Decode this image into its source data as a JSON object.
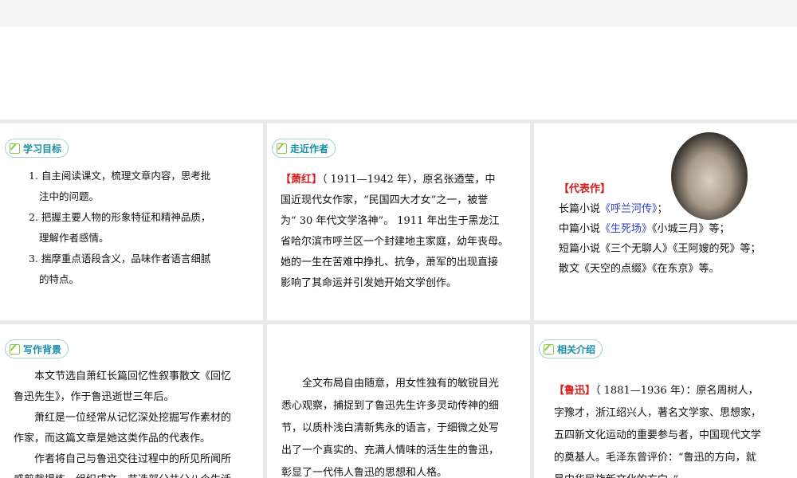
{
  "slides": {
    "goals": {
      "tag": "学习目标",
      "items": [
        {
          "line1": "1. 自主阅读课文，梳理文章内容，思考批",
          "line2": "注中的问题。"
        },
        {
          "line1": "2. 把握主要人物的形象特征和精神品质，",
          "line2": "理解作者感情。"
        },
        {
          "line1": "3. 揣摩重点语段含义，品味作者语言细腻",
          "line2": "的特点。"
        }
      ]
    },
    "author": {
      "tag": "走近作者",
      "name": "【萧红】",
      "lines": [
        "（ 1911—1942 年），原名张迺莹，中",
        "国近现代女作家，“民国四大才女”之一，被誉",
        "为“ 30 年代文学洛神”。 1911 年出生于黑龙江",
        "省哈尔滨市呼兰区一个封建地主家庭，幼年丧母。",
        "她的一生在苦难中挣扎、抗争，萧军的出现直接",
        "影响了其命运并引发她开始文学创作。"
      ]
    },
    "works": {
      "heading": "【代表作】",
      "l1_prefix": "长篇小说",
      "l1_title": "《呼兰河传》",
      "l1_suffix": "；",
      "l2_prefix": "中篇小说",
      "l2_title": "《生死场》",
      "l2_suffix": "《小城三月》等；",
      "l3": "短篇小说《三个无聊人》《王阿嫂的死》等；",
      "l4": "散文《天空的点缀》《在东京》等。"
    },
    "background": {
      "tag": "写作背景",
      "lines": [
        "本文节选自萧红长篇回忆性叙事散文《回忆",
        "鲁迅先生》，作于鲁迅逝世三年后。",
        "萧红是一位经常从记忆深处挖掘写作素材的",
        "作家，而这篇文章是她这类作品的代表作。",
        "作者将自己与鲁迅交往过程中的所见所闻所",
        "感剪裁提炼，组织成文，节选部分共分八个生活"
      ]
    },
    "layout": {
      "lines": [
        "全文布局自由随意，用女性独有的敏锐目光",
        "悉心观察，捕捉到了鲁迅先生许多灵动传神的细",
        "节，以质朴浅白清新隽永的语言，于细微之处写",
        "出了一个真实的、充满人情味的活生生的鲁迅，",
        "彰显了一代伟人鲁迅的思想和人格。"
      ]
    },
    "related": {
      "tag": "相关介绍",
      "name": "【鲁迅】",
      "lines": [
        "（ 1881—1936 年）：原名周树人，",
        "字豫才，浙江绍兴人，著名文学家、思想家，",
        "五四新文化运动的重要参与者，中国现代文学",
        "的奠基人。毛泽东曾评价：“鲁迅的方向，就",
        "是中华民族新文化的方向。”"
      ]
    }
  }
}
